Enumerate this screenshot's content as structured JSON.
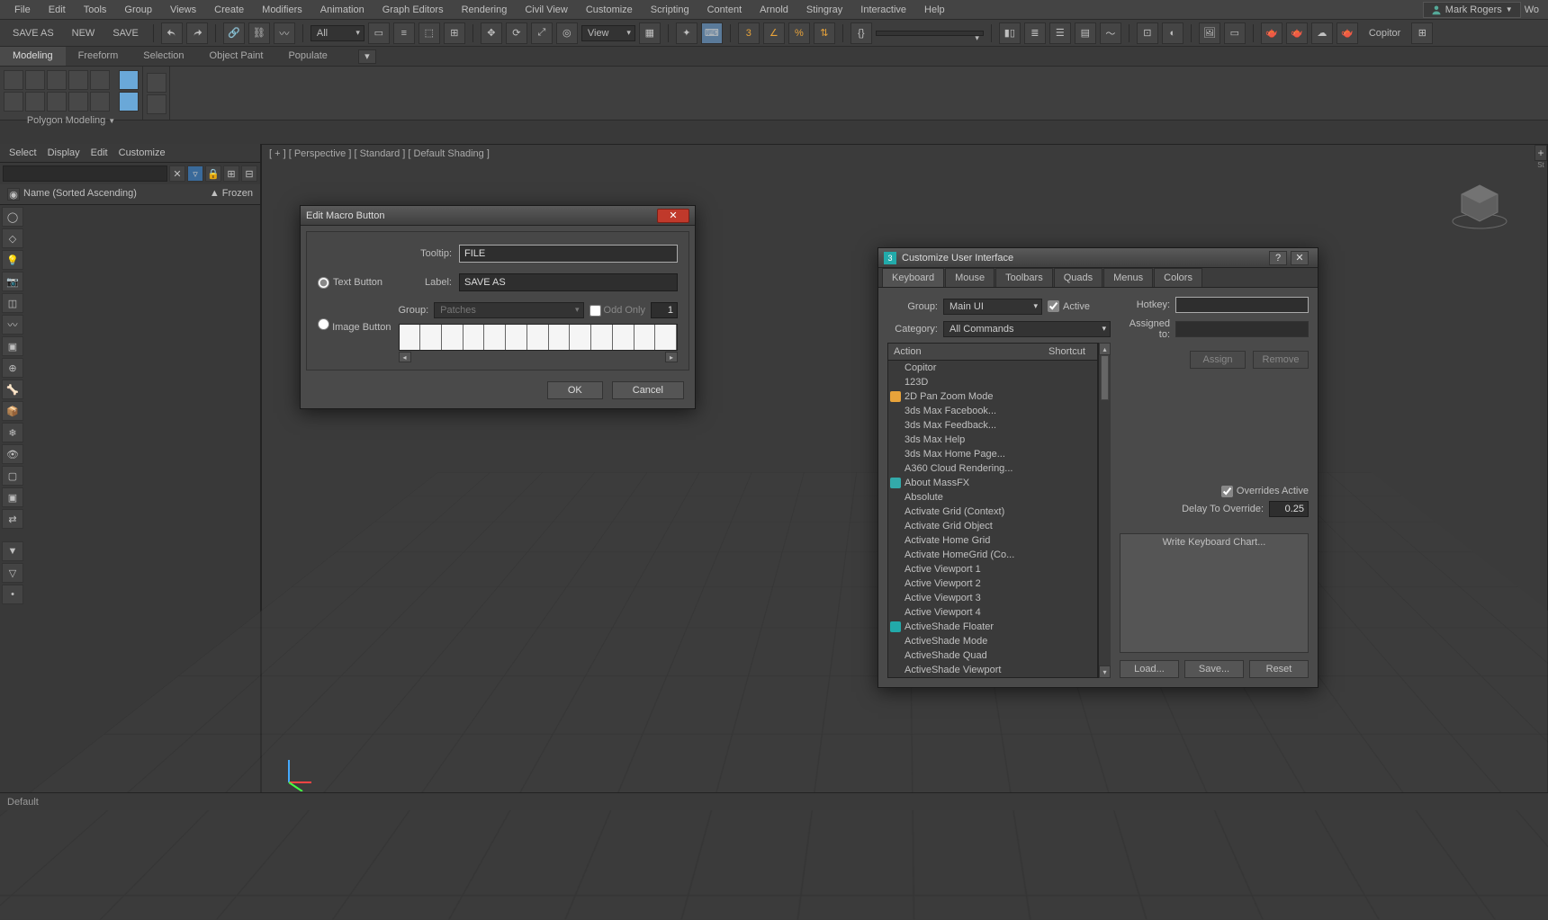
{
  "menubar": [
    "File",
    "Edit",
    "Tools",
    "Group",
    "Views",
    "Create",
    "Modifiers",
    "Animation",
    "Graph Editors",
    "Rendering",
    "Civil View",
    "Customize",
    "Scripting",
    "Content",
    "Arnold",
    "Stingray",
    "Interactive",
    "Help"
  ],
  "user": "Mark Rogers",
  "user_extra": "Wo",
  "quick_access": [
    "SAVE AS",
    "NEW",
    "SAVE"
  ],
  "toolbar": {
    "filter_dropdown": "All",
    "view_dropdown": "View",
    "create_dropdown": "",
    "copitor": "Copitor"
  },
  "ribbon_tabs": [
    "Modeling",
    "Freeform",
    "Selection",
    "Object Paint",
    "Populate"
  ],
  "ribbon_active": 0,
  "ribbon_group_label": "Polygon Modeling",
  "left_panel": {
    "tabs": [
      "Select",
      "Display",
      "Edit",
      "Customize"
    ],
    "header_col1": "Name (Sorted Ascending)",
    "header_col2": "▲ Frozen"
  },
  "viewport_label": "[ + ] [ Perspective ] [ Standard ] [ Default Shading ]",
  "edit_macro": {
    "title": "Edit Macro Button",
    "tooltip_label": "Tooltip:",
    "tooltip_value": "FILE",
    "text_radio": "Text Button",
    "image_radio": "Image Button",
    "label_label": "Label:",
    "label_value": "SAVE AS",
    "group_label": "Group:",
    "group_value": "Patches",
    "odd_only": "Odd Only",
    "spinner": "1",
    "ok": "OK",
    "cancel": "Cancel"
  },
  "cui": {
    "title": "Customize User Interface",
    "tabs": [
      "Keyboard",
      "Mouse",
      "Toolbars",
      "Quads",
      "Menus",
      "Colors"
    ],
    "active_tab": 0,
    "group_label": "Group:",
    "group_value": "Main UI",
    "active_chk": "Active",
    "category_label": "Category:",
    "category_value": "All Commands",
    "list_head_action": "Action",
    "list_head_shortcut": "Shortcut",
    "actions": [
      {
        "t": "Copitor"
      },
      {
        "t": "123D"
      },
      {
        "t": "2D Pan Zoom Mode",
        "ico": "key"
      },
      {
        "t": "3ds Max Facebook..."
      },
      {
        "t": "3ds Max Feedback..."
      },
      {
        "t": "3ds Max Help"
      },
      {
        "t": "3ds Max Home Page..."
      },
      {
        "t": "A360 Cloud Rendering..."
      },
      {
        "t": "About MassFX",
        "ico": "info"
      },
      {
        "t": "Absolute"
      },
      {
        "t": "Activate Grid (Context)"
      },
      {
        "t": "Activate Grid Object"
      },
      {
        "t": "Activate Home Grid"
      },
      {
        "t": "Activate HomeGrid (Co..."
      },
      {
        "t": "Active Viewport 1"
      },
      {
        "t": "Active Viewport 2"
      },
      {
        "t": "Active Viewport 3"
      },
      {
        "t": "Active Viewport 4"
      },
      {
        "t": "ActiveShade Floater",
        "ico": "teal"
      },
      {
        "t": "ActiveShade Mode"
      },
      {
        "t": "ActiveShade Quad"
      },
      {
        "t": "ActiveShade Viewport"
      }
    ],
    "hotkey_label": "Hotkey:",
    "assigned_label": "Assigned to:",
    "assign": "Assign",
    "remove": "Remove",
    "overrides": "Overrides Active",
    "delay_label": "Delay To Override:",
    "delay_value": "0.25",
    "write_chart": "Write Keyboard Chart...",
    "load": "Load...",
    "save": "Save...",
    "reset": "Reset"
  },
  "status_text": "Default"
}
